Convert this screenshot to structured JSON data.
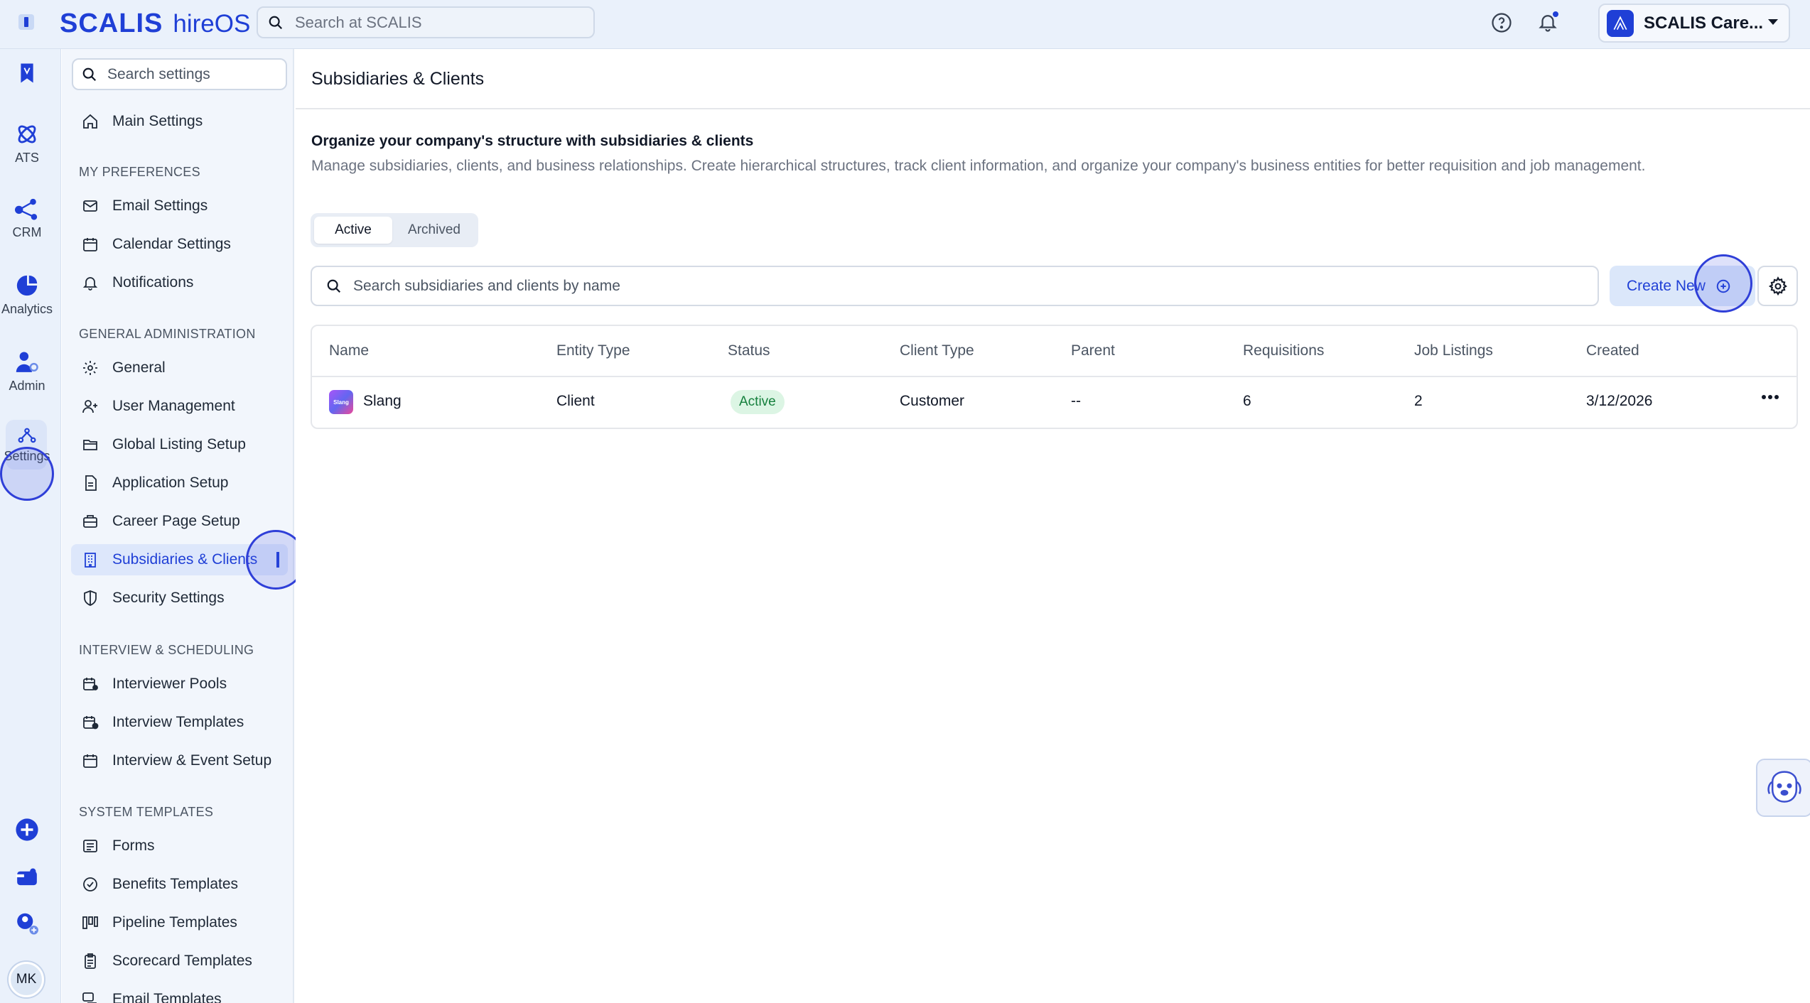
{
  "topbar": {
    "brand": "SCALIS",
    "product": "hireOS",
    "search_placeholder": "Search at SCALIS",
    "account_name": "SCALIS Care..."
  },
  "rail": {
    "items": [
      {
        "label": "ATS",
        "icon": "atom-icon"
      },
      {
        "label": "CRM",
        "icon": "network-icon"
      },
      {
        "label": "Analytics",
        "icon": "pie-chart-icon"
      },
      {
        "label": "Admin",
        "icon": "user-gear-icon"
      },
      {
        "label": "Settings",
        "icon": "settings-nodes-icon"
      }
    ],
    "avatar_initials": "MK"
  },
  "sidebar": {
    "search_placeholder": "Search settings",
    "main_settings": "Main Settings",
    "sections": {
      "preferences": "MY PREFERENCES",
      "administration": "GENERAL ADMINISTRATION",
      "interview": "INTERVIEW & SCHEDULING",
      "templates": "SYSTEM TEMPLATES"
    },
    "items": {
      "email": "Email Settings",
      "calendar": "Calendar Settings",
      "notifications": "Notifications",
      "general": "General",
      "users": "User Management",
      "listing": "Global Listing Setup",
      "application": "Application Setup",
      "career": "Career Page Setup",
      "subsidiaries": "Subsidiaries & Clients",
      "security": "Security Settings",
      "pools": "Interviewer Pools",
      "interview_templates": "Interview Templates",
      "event_setup": "Interview & Event Setup",
      "forms": "Forms",
      "benefits": "Benefits Templates",
      "pipeline": "Pipeline Templates",
      "scorecard": "Scorecard Templates",
      "email_templates": "Email Templates"
    }
  },
  "main": {
    "page_title": "Subsidiaries & Clients",
    "intro_title": "Organize your company's structure with subsidiaries & clients",
    "intro_desc": "Manage subsidiaries, clients, and business relationships. Create hierarchical structures, track client information, and organize your company's business entities for better requisition and job management.",
    "tabs": {
      "active": "Active",
      "archived": "Archived"
    },
    "search_placeholder": "Search subsidiaries and clients by name",
    "create_label": "Create New",
    "table": {
      "headers": {
        "name": "Name",
        "entity_type": "Entity Type",
        "status": "Status",
        "client_type": "Client Type",
        "parent": "Parent",
        "requisitions": "Requisitions",
        "job_listings": "Job Listings",
        "created": "Created"
      },
      "rows": [
        {
          "logo_text": "Slang",
          "name": "Slang",
          "entity_type": "Client",
          "status": "Active",
          "client_type": "Customer",
          "parent": "--",
          "requisitions": "6",
          "job_listings": "2",
          "created": "3/12/2026"
        }
      ]
    }
  },
  "colors": {
    "accent": "#1f3fd6",
    "topbar_bg": "#eaf1fb",
    "active_badge_bg": "#dcf5e4",
    "active_badge_text": "#15803d"
  }
}
